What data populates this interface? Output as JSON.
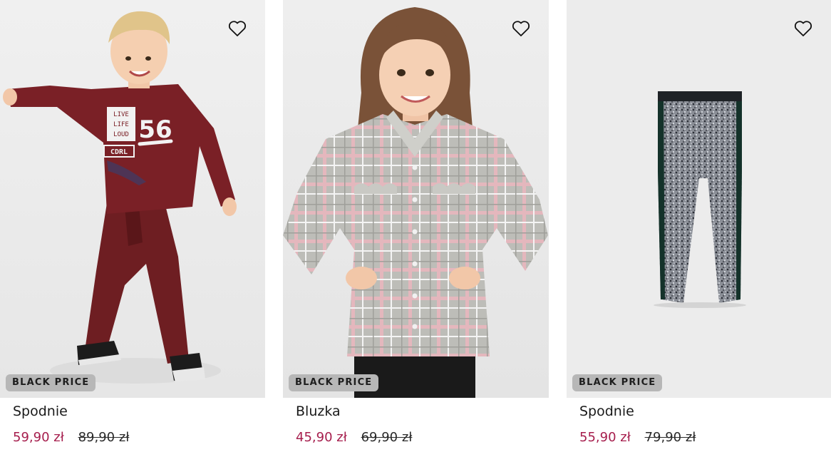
{
  "colors": {
    "sale_price": "#a61e4d",
    "badge_bg": "#b7b7b7",
    "text": "#1a1a1a"
  },
  "products": [
    {
      "name": "Spodnie",
      "price_new": "59,90 zł",
      "price_old": "89,90 zł",
      "badge": "BLACK PRICE",
      "image": "boy-in-maroon-sweatshirt-and-trousers",
      "print_text": [
        "LIVE",
        "LIFE",
        "LOUD",
        "56",
        "CDRL"
      ]
    },
    {
      "name": "Bluzka",
      "price_new": "45,90 zł",
      "price_old": "69,90 zł",
      "badge": "BLACK PRICE",
      "image": "girl-in-grey-pink-plaid-shirt"
    },
    {
      "name": "Spodnie",
      "price_new": "55,90 zł",
      "price_old": "79,90 zł",
      "badge": "BLACK PRICE",
      "image": "grey-patterned-leggings"
    }
  ]
}
